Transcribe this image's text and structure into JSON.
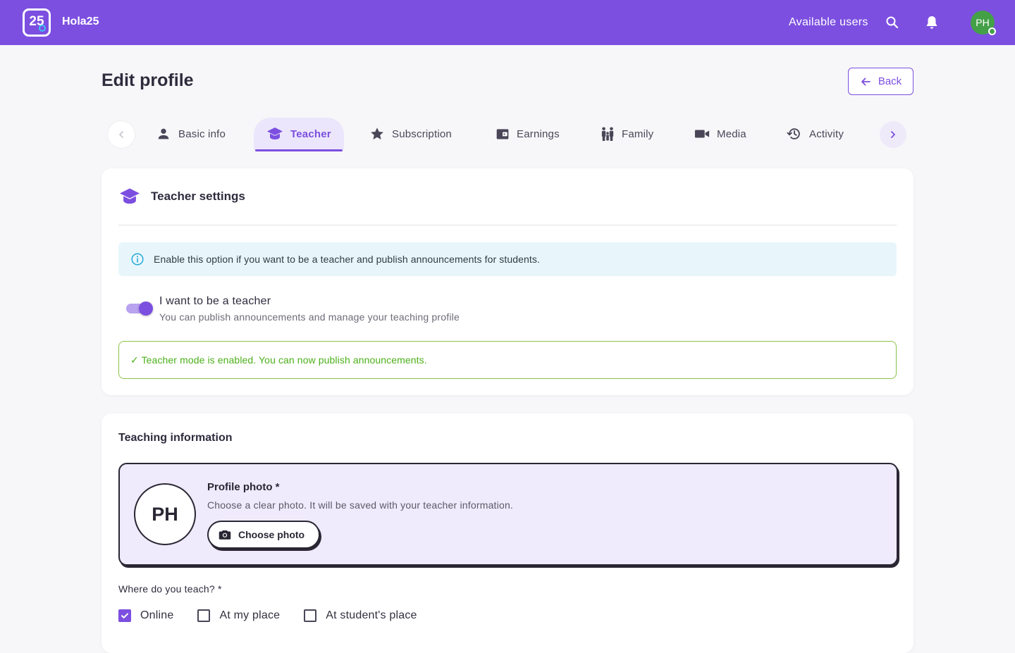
{
  "app": {
    "logo_text": "25",
    "brand": "Hola25",
    "accent_color": "#7c4fe0"
  },
  "topbar": {
    "available_users": "Available users",
    "icons": [
      "search-icon",
      "bell-icon"
    ],
    "avatar_initials": "PH"
  },
  "page": {
    "title": "Edit profile",
    "back_label": "Back"
  },
  "tabs": [
    {
      "label": "Basic info",
      "icon": "person-icon",
      "active": false
    },
    {
      "label": "Teacher",
      "icon": "graduation-cap-icon",
      "active": true
    },
    {
      "label": "Subscription",
      "icon": "star-icon",
      "active": false
    },
    {
      "label": "Earnings",
      "icon": "wallet-icon",
      "active": false
    },
    {
      "label": "Family",
      "icon": "family-icon",
      "active": false
    },
    {
      "label": "Media",
      "icon": "video-camera-icon",
      "active": false
    },
    {
      "label": "Activity",
      "icon": "history-icon",
      "active": false
    }
  ],
  "teacher_settings": {
    "title": "Teacher settings",
    "info": "Enable this option if you want to be a teacher and publish announcements for students.",
    "toggle_title": "I want to be a teacher",
    "toggle_sub": "You can publish announcements and manage your teaching profile",
    "toggle_on": true,
    "success": "✓ Teacher mode is enabled. You can now publish announcements."
  },
  "teaching_info": {
    "title": "Teaching information",
    "photo_initials": "PH",
    "photo_title": "Profile photo *",
    "photo_desc": "Choose a clear photo. It will be saved with your teacher information.",
    "choose_label": "Choose photo",
    "where_label": "Where do you teach? *",
    "options": [
      {
        "label": "Online",
        "checked": true
      },
      {
        "label": "At my place",
        "checked": false
      },
      {
        "label": "At student's place",
        "checked": false
      }
    ]
  }
}
